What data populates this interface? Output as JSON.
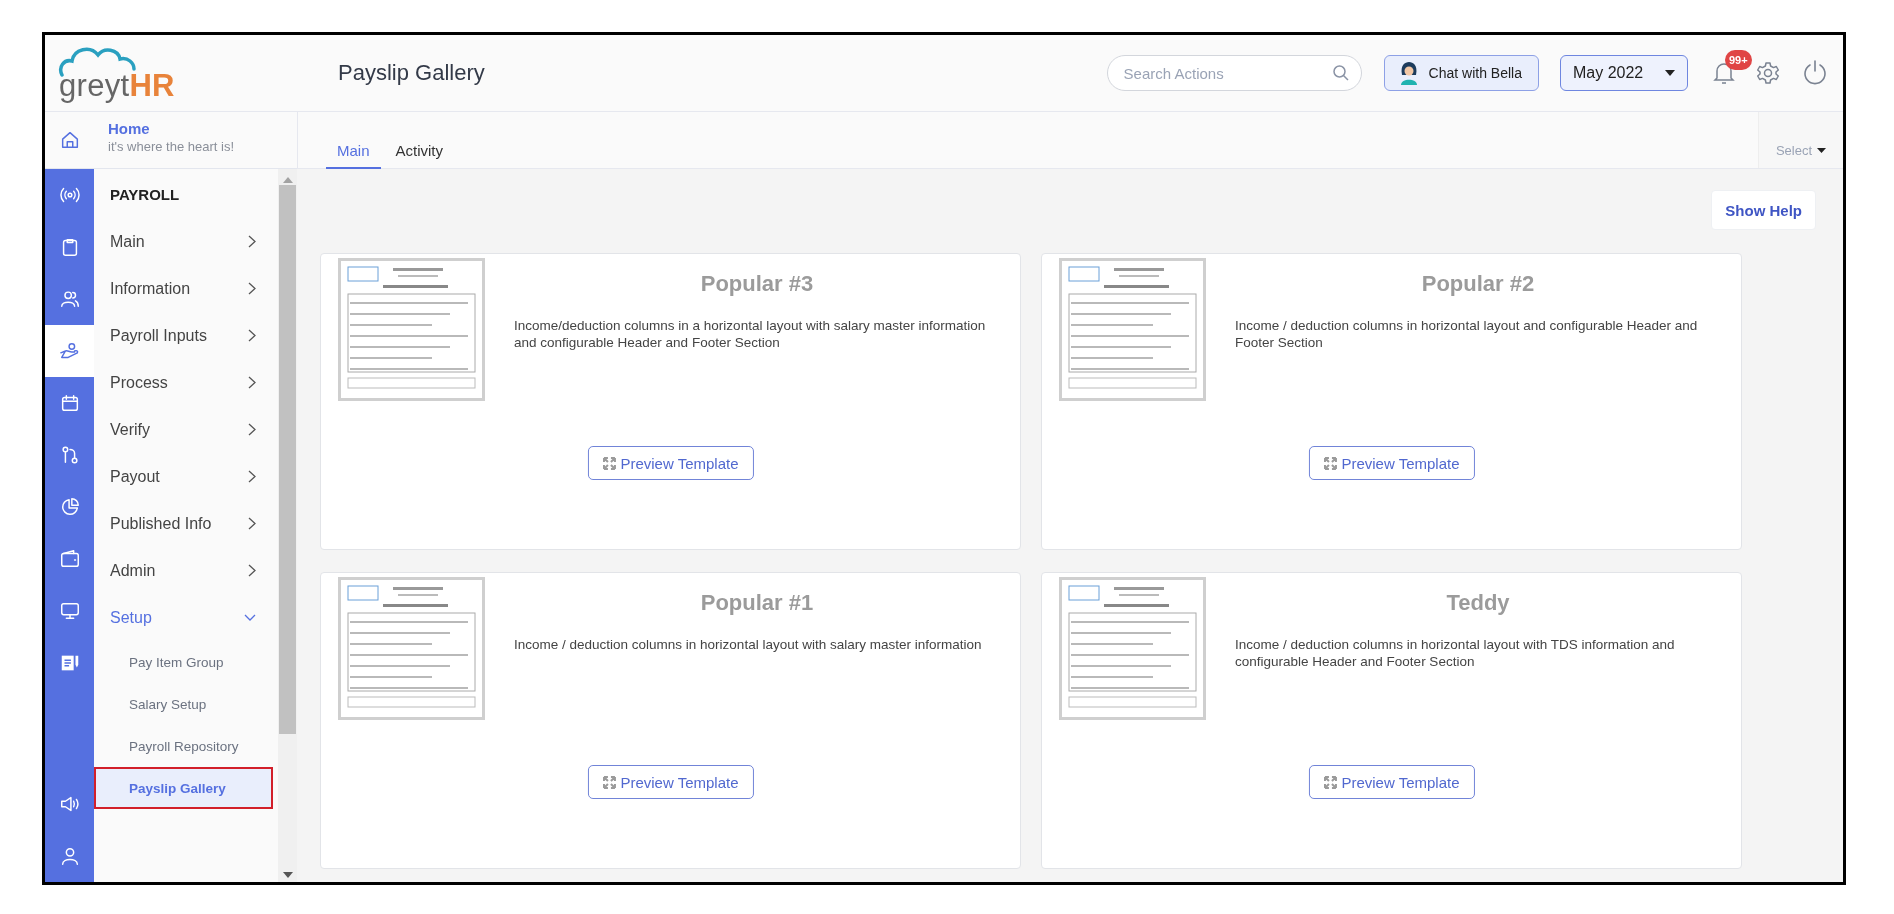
{
  "logo": {
    "text": "greyt",
    "accent": "HR"
  },
  "topbar": {
    "title": "Payslip Gallery",
    "search": {
      "placeholder": "Search Actions"
    },
    "chat_button": "Chat with Bella",
    "month": "May 2022",
    "notification_badge": "99+"
  },
  "home": {
    "title": "Home",
    "subtitle": "it's where the heart is!"
  },
  "rail": [
    {
      "kind": "broadcast",
      "selected": false
    },
    {
      "kind": "clipboard",
      "selected": false
    },
    {
      "kind": "people",
      "selected": false
    },
    {
      "kind": "hand",
      "selected": true
    },
    {
      "kind": "calendar",
      "selected": false
    },
    {
      "kind": "flow",
      "selected": false
    },
    {
      "kind": "pie",
      "selected": false
    },
    {
      "kind": "wallet",
      "selected": false
    },
    {
      "kind": "monitor",
      "selected": false
    },
    {
      "kind": "document",
      "selected": false
    }
  ],
  "rail_bottom": [
    {
      "kind": "speaker",
      "selected": false
    },
    {
      "kind": "user",
      "selected": false
    }
  ],
  "menu": {
    "heading": "PAYROLL",
    "items": [
      {
        "label": "Main",
        "expanded": false
      },
      {
        "label": "Information",
        "expanded": false
      },
      {
        "label": "Payroll Inputs",
        "expanded": false
      },
      {
        "label": "Process",
        "expanded": false
      },
      {
        "label": "Verify",
        "expanded": false
      },
      {
        "label": "Payout",
        "expanded": false
      },
      {
        "label": "Published Info",
        "expanded": false
      },
      {
        "label": "Admin",
        "expanded": false
      },
      {
        "label": "Setup",
        "expanded": true,
        "children": [
          {
            "label": "Pay Item Group",
            "selected": false
          },
          {
            "label": "Salary Setup",
            "selected": false
          },
          {
            "label": "Payroll Repository",
            "selected": false
          },
          {
            "label": "Payslip Gallery",
            "selected": true
          }
        ]
      }
    ]
  },
  "tabs": [
    {
      "label": "Main",
      "selected": true
    },
    {
      "label": "Activity",
      "selected": false
    }
  ],
  "select": "Select",
  "show_help": "Show Help",
  "templates": [
    {
      "name": "Popular #3",
      "description": "Income/deduction columns in a horizontal layout with salary master information and configurable Header and Footer Section",
      "button": "Preview Template"
    },
    {
      "name": "Popular #2",
      "description": "Income / deduction columns in horizontal layout and configurable Header and Footer Section",
      "button": "Preview Template"
    },
    {
      "name": "Popular #1",
      "description": "Income / deduction columns in horizontal layout with salary master information",
      "button": "Preview Template"
    },
    {
      "name": "Teddy",
      "description": "Income / deduction columns in horizontal layout with TDS information and configurable Header and Footer Section",
      "button": "Preview Template"
    }
  ]
}
